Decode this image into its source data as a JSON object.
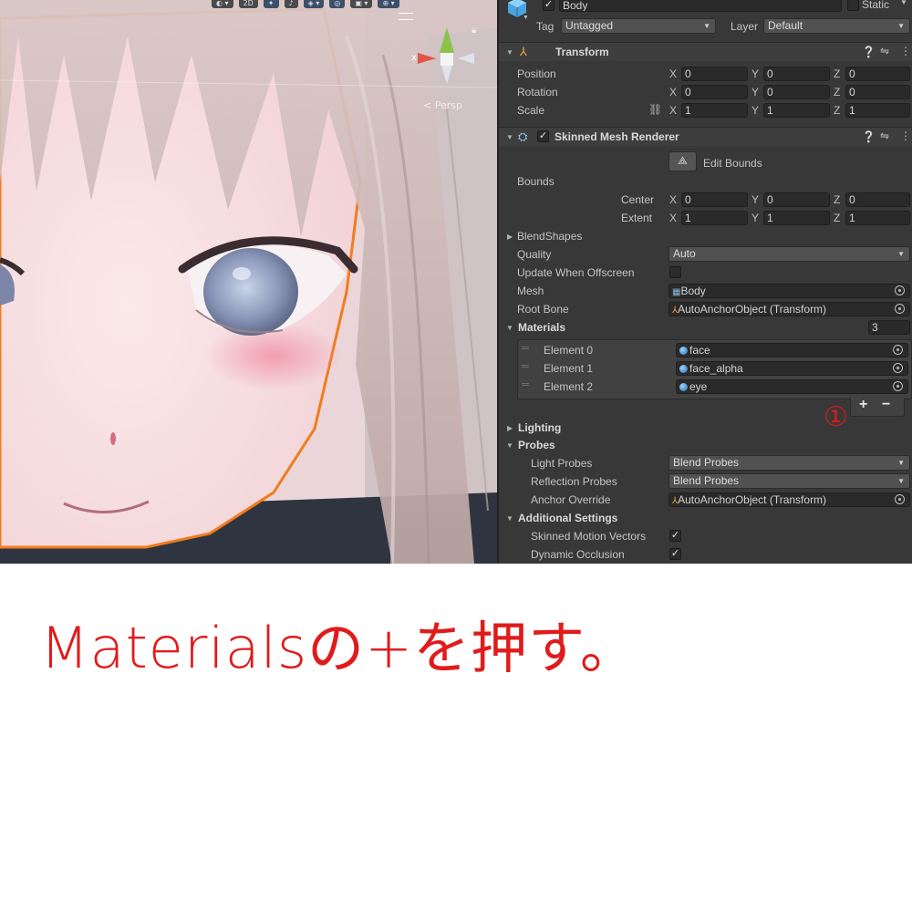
{
  "scene": {
    "toolbar": [
      "",
      "2D",
      "",
      "",
      "",
      "",
      "",
      ""
    ],
    "persp_label": "< Persp",
    "gizmo_x": "x"
  },
  "inspector": {
    "object_name": "Body",
    "static_label": "Static",
    "tag_label": "Tag",
    "tag_value": "Untagged",
    "layer_label": "Layer",
    "layer_value": "Default",
    "transform": {
      "title": "Transform",
      "position": {
        "label": "Position",
        "x": "0",
        "y": "0",
        "z": "0"
      },
      "rotation": {
        "label": "Rotation",
        "x": "0",
        "y": "0",
        "z": "0"
      },
      "scale": {
        "label": "Scale",
        "x": "1",
        "y": "1",
        "z": "1"
      }
    },
    "smr": {
      "title": "Skinned Mesh Renderer",
      "edit_bounds": "Edit Bounds",
      "bounds_label": "Bounds",
      "center": {
        "label": "Center",
        "x": "0",
        "y": "0",
        "z": "0"
      },
      "extent": {
        "label": "Extent",
        "x": "1",
        "y": "1",
        "z": "1"
      },
      "blendshapes": "BlendShapes",
      "quality_label": "Quality",
      "quality_value": "Auto",
      "update_offscreen": "Update When Offscreen",
      "mesh_label": "Mesh",
      "mesh_value": "Body",
      "root_bone_label": "Root Bone",
      "root_bone_value": "AutoAnchorObject (Transform)",
      "materials_label": "Materials",
      "materials_count": "3",
      "elements": [
        {
          "label": "Element 0",
          "value": "face"
        },
        {
          "label": "Element 1",
          "value": "face_alpha"
        },
        {
          "label": "Element 2",
          "value": "eye"
        }
      ],
      "plus": "+",
      "minus": "−",
      "annotation_marker": "①",
      "lighting": "Lighting",
      "probes": "Probes",
      "light_probes_label": "Light Probes",
      "light_probes_value": "Blend Probes",
      "reflection_probes_label": "Reflection Probes",
      "reflection_probes_value": "Blend Probes",
      "anchor_override_label": "Anchor Override",
      "anchor_override_value": "AutoAnchorObject (Transform)",
      "additional_settings": "Additional Settings",
      "skinned_motion_vectors": "Skinned Motion Vectors",
      "dynamic_occlusion": "Dynamic Occlusion"
    }
  },
  "caption": "Materialsの+を押す。",
  "colors": {
    "caption": "#e11b1b",
    "inspector_bg": "#383838",
    "field_bg": "#2a2a2a",
    "selection_outline": "#f07c1e"
  }
}
